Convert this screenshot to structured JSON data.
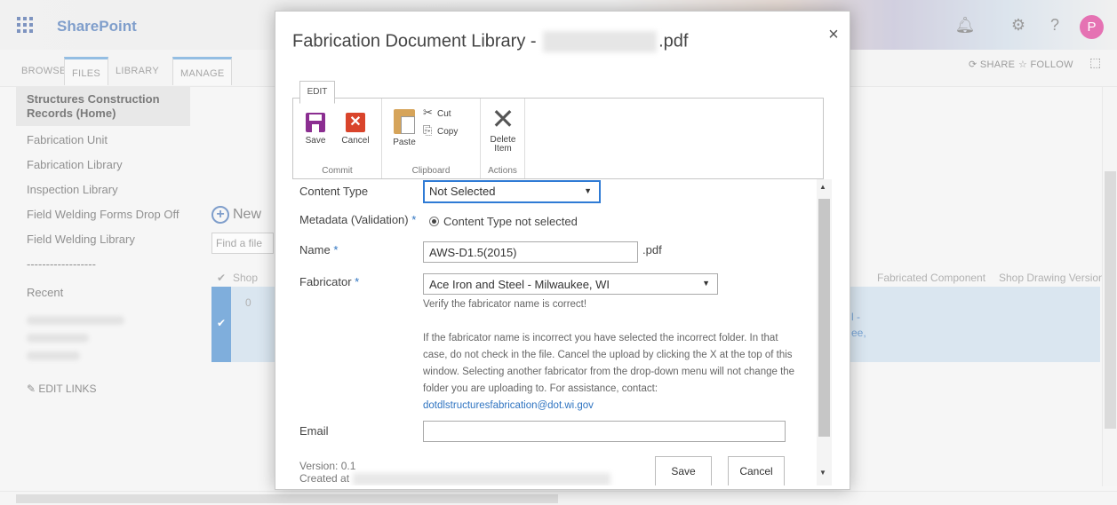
{
  "suitebar": {
    "brand": "SharePoint",
    "avatar_letter": "P"
  },
  "ribbon_tabs": [
    "BROWSE",
    "FILES",
    "LIBRARY",
    "MANAGE"
  ],
  "ribbon_actions": {
    "share": "SHARE",
    "follow": "FOLLOW"
  },
  "leftnav": {
    "items": [
      "Structures Construction Records (Home)",
      "Fabrication Unit",
      "Fabrication Library",
      "Inspection Library",
      "Field Welding Forms Drop Off",
      "Field Welding Library",
      "------------------",
      "Recent"
    ],
    "edit_links": "EDIT LINKS"
  },
  "library": {
    "new_label": "New",
    "find_placeholder": "Find a file",
    "col_shop": "Shop",
    "col_fabricated": "Fabricated Component",
    "col_shop_drawing": "Shop Drawing Version",
    "row_value": "0",
    "row_fragment_1": "l -",
    "row_fragment_2": "ee,"
  },
  "dialog": {
    "title_prefix": "Fabrication Document Library -",
    "title_suffix": ".pdf",
    "close": "×",
    "edit_tab": "EDIT",
    "ribbon": {
      "save": "Save",
      "cancel": "Cancel",
      "commit": "Commit",
      "paste": "Paste",
      "cut": "Cut",
      "copy": "Copy",
      "clipboard": "Clipboard",
      "delete_item_1": "Delete",
      "delete_item_2": "Item",
      "actions": "Actions"
    },
    "form": {
      "content_type_label": "Content Type",
      "content_type_value": "Not Selected",
      "metadata_label": "Metadata (Validation)",
      "metadata_value": "Content Type not selected",
      "name_label": "Name",
      "name_value": "AWS-D1.5(2015)",
      "name_ext": ".pdf",
      "fabricator_label": "Fabricator",
      "fabricator_value": "Ace Iron and Steel - Milwaukee, WI",
      "verify_text": "Verify the fabricator name is correct!",
      "help_text": "If the fabricator name is incorrect you have selected the incorrect folder. In that case, do not check in the file. Cancel the upload by clicking the X at the top of this window. Selecting another fabricator from the drop-down menu will not change the folder you are uploading to. For assistance, contact:",
      "help_email": "dotdlstructuresfabrication@dot.wi.gov",
      "email_label": "Email",
      "required_mark": "*",
      "version": "Version: 0.1",
      "created_at": "Created at",
      "save_button": "Save",
      "cancel_button": "Cancel"
    }
  },
  "colors": {
    "brand": "#3b6ab0",
    "focus": "#2f7bd5",
    "selected_row": "#c7d9e8",
    "avatar": "#d7278a"
  }
}
